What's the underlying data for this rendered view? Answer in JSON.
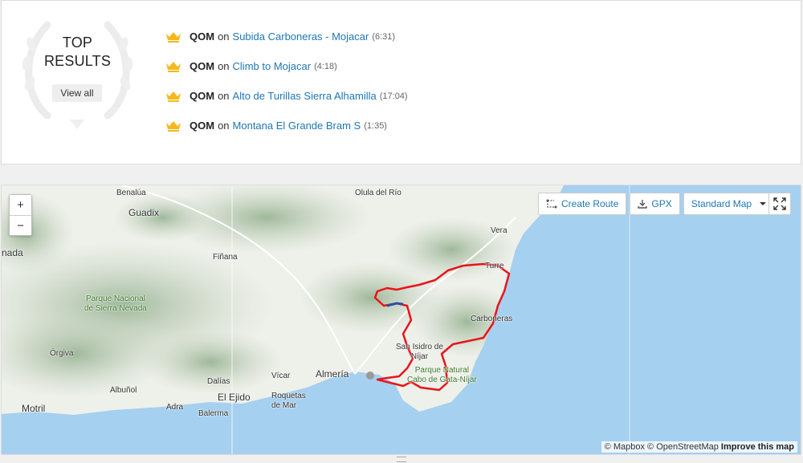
{
  "top_results": {
    "title_line1": "TOP",
    "title_line2": "RESULTS",
    "view_all": "View all",
    "items": [
      {
        "badge": "QOM",
        "on": "on",
        "segment": "Subida Carboneras - Mojacar",
        "time": "(6:31)"
      },
      {
        "badge": "QOM",
        "on": "on",
        "segment": "Climb to Mojacar",
        "time": "(4:18)"
      },
      {
        "badge": "QOM",
        "on": "on",
        "segment": "Alto de Turillas Sierra Alhamilla",
        "time": "(17:04)"
      },
      {
        "badge": "QOM",
        "on": "on",
        "segment": "Montana El Grande Bram S",
        "time": "(1:35)"
      }
    ],
    "crown_color": "#f5b81c"
  },
  "map": {
    "zoom_in": "+",
    "zoom_out": "−",
    "create_route": "Create Route",
    "gpx": "GPX",
    "map_style": "Standard Map",
    "attribution_mapbox": "© Mapbox",
    "attribution_osm": "© OpenStreetMap",
    "attribution_improve": "Improve this map",
    "route_color": "#e8141b",
    "segment_color": "#2e4fa3",
    "sea_color": "#a6d0ef",
    "places": {
      "benalua": "Benalúa",
      "guadix": "Guadix",
      "olula": "Olula del Río",
      "vera": "Vera",
      "nada": "nada",
      "fin": "Fiñana",
      "turre": "Turre",
      "pn_sierra_nevada_1": "Parque Nacional",
      "pn_sierra_nevada_2": "de Sierra Nevada",
      "carboneras": "Carboneras",
      "san_isidro_1": "San Isidro de",
      "san_isidro_2": "Níjar",
      "orgiva": "Órgiva",
      "almeria": "Almería",
      "vicar": "Vícar",
      "dalias": "Dalías",
      "parque_natural_1": "Parque Natural",
      "parque_natural_2": "Cabo de Gata-Níjar",
      "albunol": "Albuñol",
      "el_ejido": "El Ejido",
      "roquetas_1": "Roquetas",
      "roquetas_2": "de Mar",
      "motril": "Motril",
      "adra": "Adra",
      "balerma": "Balerma"
    }
  }
}
